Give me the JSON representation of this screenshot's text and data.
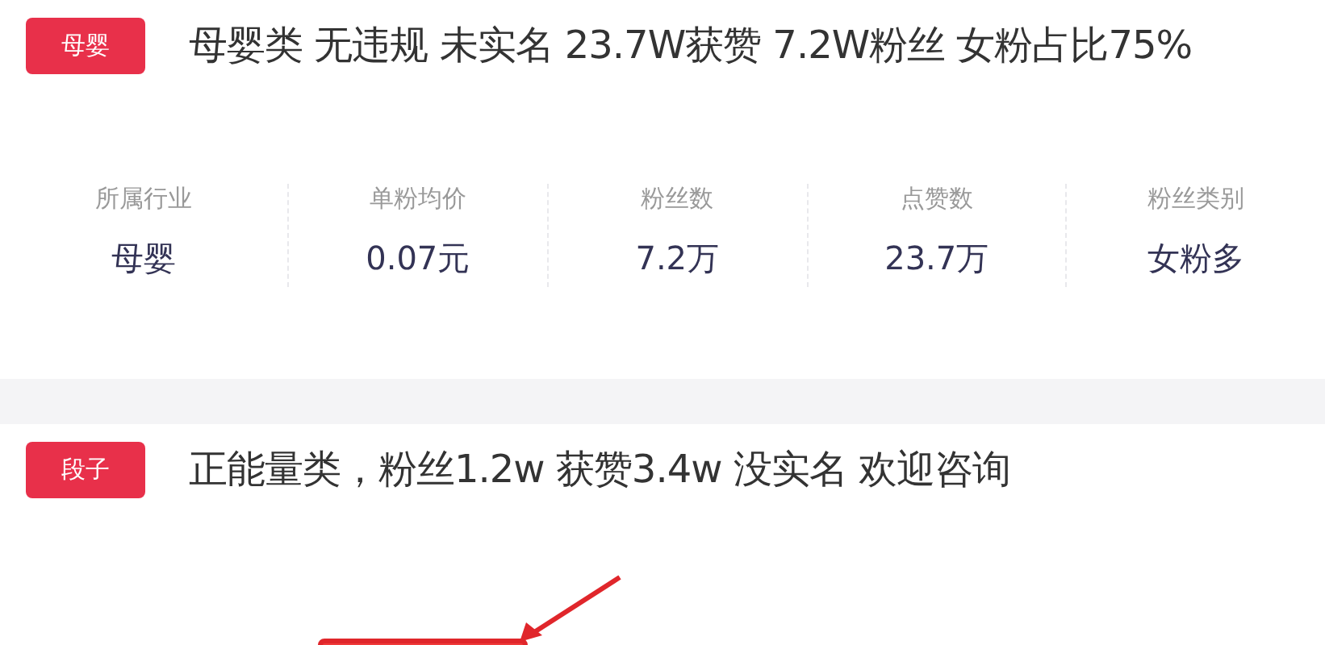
{
  "listings": [
    {
      "tag": "母婴",
      "title": "母婴类 无违规 未实名 23.7W获赞 7.2W粉丝 女粉占比75%",
      "stats": [
        {
          "label": "所属行业",
          "value": "母婴"
        },
        {
          "label": "单粉均价",
          "value": "0.07元"
        },
        {
          "label": "粉丝数",
          "value": "7.2万"
        },
        {
          "label": "点赞数",
          "value": "23.7万"
        },
        {
          "label": "粉丝类别",
          "value": "女粉多"
        }
      ]
    },
    {
      "tag": "段子",
      "title": "正能量类，粉丝1.2w 获赞3.4w 没实名 欢迎咨询"
    }
  ]
}
